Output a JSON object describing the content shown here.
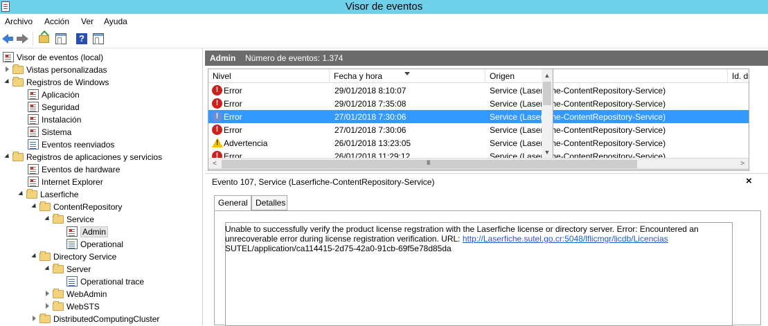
{
  "window": {
    "title": "Visor de eventos"
  },
  "menu": {
    "archivo": "Archivo",
    "accion": "Acción",
    "ver": "Ver",
    "ayuda": "Ayuda"
  },
  "toolbar": {
    "help_glyph": "?"
  },
  "tree": {
    "root": "Visor de eventos (local)",
    "vistas": "Vistas personalizadas",
    "registros_windows": "Registros de Windows",
    "aplicacion": "Aplicación",
    "seguridad": "Seguridad",
    "instalacion": "Instalación",
    "sistema": "Sistema",
    "eventos_reenviados": "Eventos reenviados",
    "registros_apps": "Registros de aplicaciones y servicios",
    "eventos_hardware": "Eventos de hardware",
    "internet_explorer": "Internet Explorer",
    "laserfiche": "Laserfiche",
    "content_repository": "ContentRepository",
    "service": "Service",
    "admin": "Admin",
    "operational": "Operational",
    "directory_service": "Directory Service",
    "server": "Server",
    "operational_trace": "Operational trace",
    "webadmin": "WebAdmin",
    "websts": "WebSTS",
    "distributed": "DistributedComputingCluster"
  },
  "panel": {
    "log_name": "Admin",
    "count_label": "Número de eventos: 1.374"
  },
  "grid": {
    "headers": {
      "nivel": "Nivel",
      "fecha": "Fecha y hora",
      "origen": "Origen",
      "id": "Id. de"
    },
    "rows": [
      {
        "level": "Error",
        "date": "29/01/2018 8:10:07",
        "source": "Service (Laserfiche-ContentRepository-Service)"
      },
      {
        "level": "Error",
        "date": "29/01/2018 7:35:08",
        "source": "Service (Laserfiche-ContentRepository-Service)"
      },
      {
        "level": "Error",
        "date": "27/01/2018 7:30:06",
        "source": "Service (Laserfiche-ContentRepository-Service)"
      },
      {
        "level": "Error",
        "date": "27/01/2018 7:30:06",
        "source": "Service (Laserfiche-ContentRepository-Service)"
      },
      {
        "level": "Advertencia",
        "date": "26/01/2018 13:23:05",
        "source": "Service (Laserfiche-ContentRepository-Service)"
      },
      {
        "level": "Error",
        "date": "26/01/2018 11:29:12",
        "source": "Service (Laserfiche-ContentRepository-Service)"
      }
    ]
  },
  "detail": {
    "title": "Evento 107, Service (Laserfiche-ContentRepository-Service)",
    "close_glyph": "×",
    "tab_general": "General",
    "tab_detalles": "Detalles",
    "desc_part1": "Unable to successfully verify the product license regstration with the Laserfiche license or directory server. Error: Encountered an unrecoverable error during license registration verification. URL: ",
    "desc_link": "http://Laserfiche.sutel.go.cr:5048/lflicmgr/licdb/Licencias",
    "desc_part2": "SUTEL/application/ca114415-2d75-42a0-91cb-69f5e78d85da"
  }
}
